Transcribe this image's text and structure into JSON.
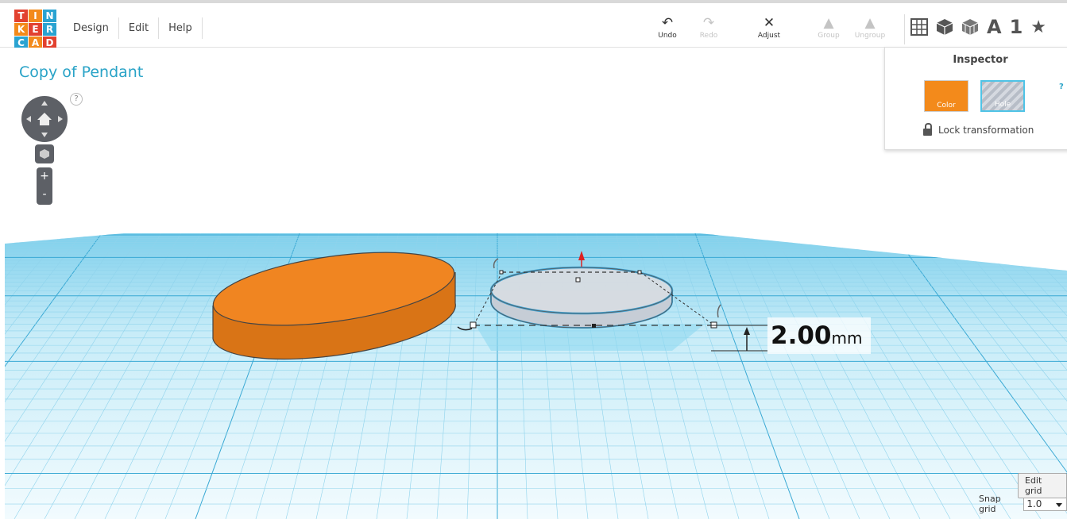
{
  "app": {
    "logo_letters": [
      "T",
      "I",
      "N",
      "K",
      "E",
      "R",
      "C",
      "A",
      "D"
    ],
    "logo_colors": [
      "#e2412f",
      "#f38a1b",
      "#2aa3d1",
      "#f38a1b",
      "#e2412f",
      "#2aa3d1",
      "#2aa3d1",
      "#f38a1b",
      "#e2412f"
    ]
  },
  "menu": {
    "items": [
      "Design",
      "Edit",
      "Help"
    ]
  },
  "toolbar": {
    "undo": "Undo",
    "redo": "Redo",
    "adjust": "Adjust",
    "group": "Group",
    "ungroup": "Ungroup",
    "text_icon": "A",
    "number_icon": "1"
  },
  "project": {
    "title": "Copy of Pendant"
  },
  "navigation": {
    "help": "?",
    "zoom_in": "+",
    "zoom_out": "-"
  },
  "inspector": {
    "title": "Inspector",
    "color_label": "Color",
    "hole_label": "Hole",
    "help": "?",
    "lock_label": "Lock transformation"
  },
  "dimension": {
    "value": "2.00",
    "unit": "mm"
  },
  "grid": {
    "edit_grid": "Edit grid",
    "snap_label": "Snap grid",
    "snap_value": "1.0"
  },
  "colors": {
    "accent": "#29a3c7",
    "shape": "#f38a1b",
    "grid": "#a9def0",
    "plane": "#c8ecf8"
  }
}
